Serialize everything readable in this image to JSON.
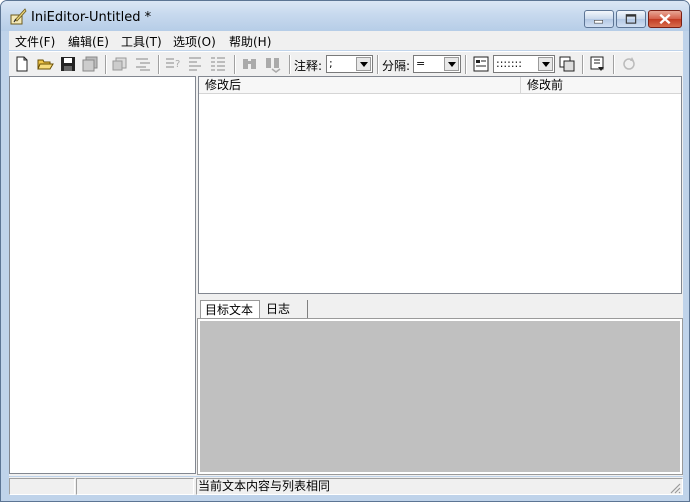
{
  "window": {
    "title": "IniEditor-Untitled *",
    "colors": {
      "frame": "#bfd3ea",
      "close": "#c23b22",
      "panel": "#c0c0c0"
    }
  },
  "menu": [
    {
      "label": "文件(F)"
    },
    {
      "label": "编辑(E)"
    },
    {
      "label": "工具(T)"
    },
    {
      "label": "选项(O)"
    },
    {
      "label": "帮助(H)"
    }
  ],
  "toolbar": {
    "icons": [
      "new-file-icon",
      "open-folder-icon",
      "save-icon",
      "save-all-icon",
      "cut-icon",
      "align-icon",
      "sort-icon",
      "align-left-icon",
      "list-icon",
      "find-icon",
      "find-replace-icon",
      "settings-icon",
      "copy-icon",
      "export-icon",
      "refresh-icon"
    ],
    "comment_label": "注释:",
    "comment_value": ";",
    "separator_label": "分隔:",
    "separator_value": "=",
    "format_value": ":::::::"
  },
  "list": {
    "columns": [
      "修改后",
      "修改前"
    ]
  },
  "tabs": [
    {
      "label": "目标文本",
      "active": true
    },
    {
      "label": "日志",
      "active": false
    }
  ],
  "status": {
    "pane1": "",
    "pane2": "",
    "message": "当前文本内容与列表相同"
  }
}
